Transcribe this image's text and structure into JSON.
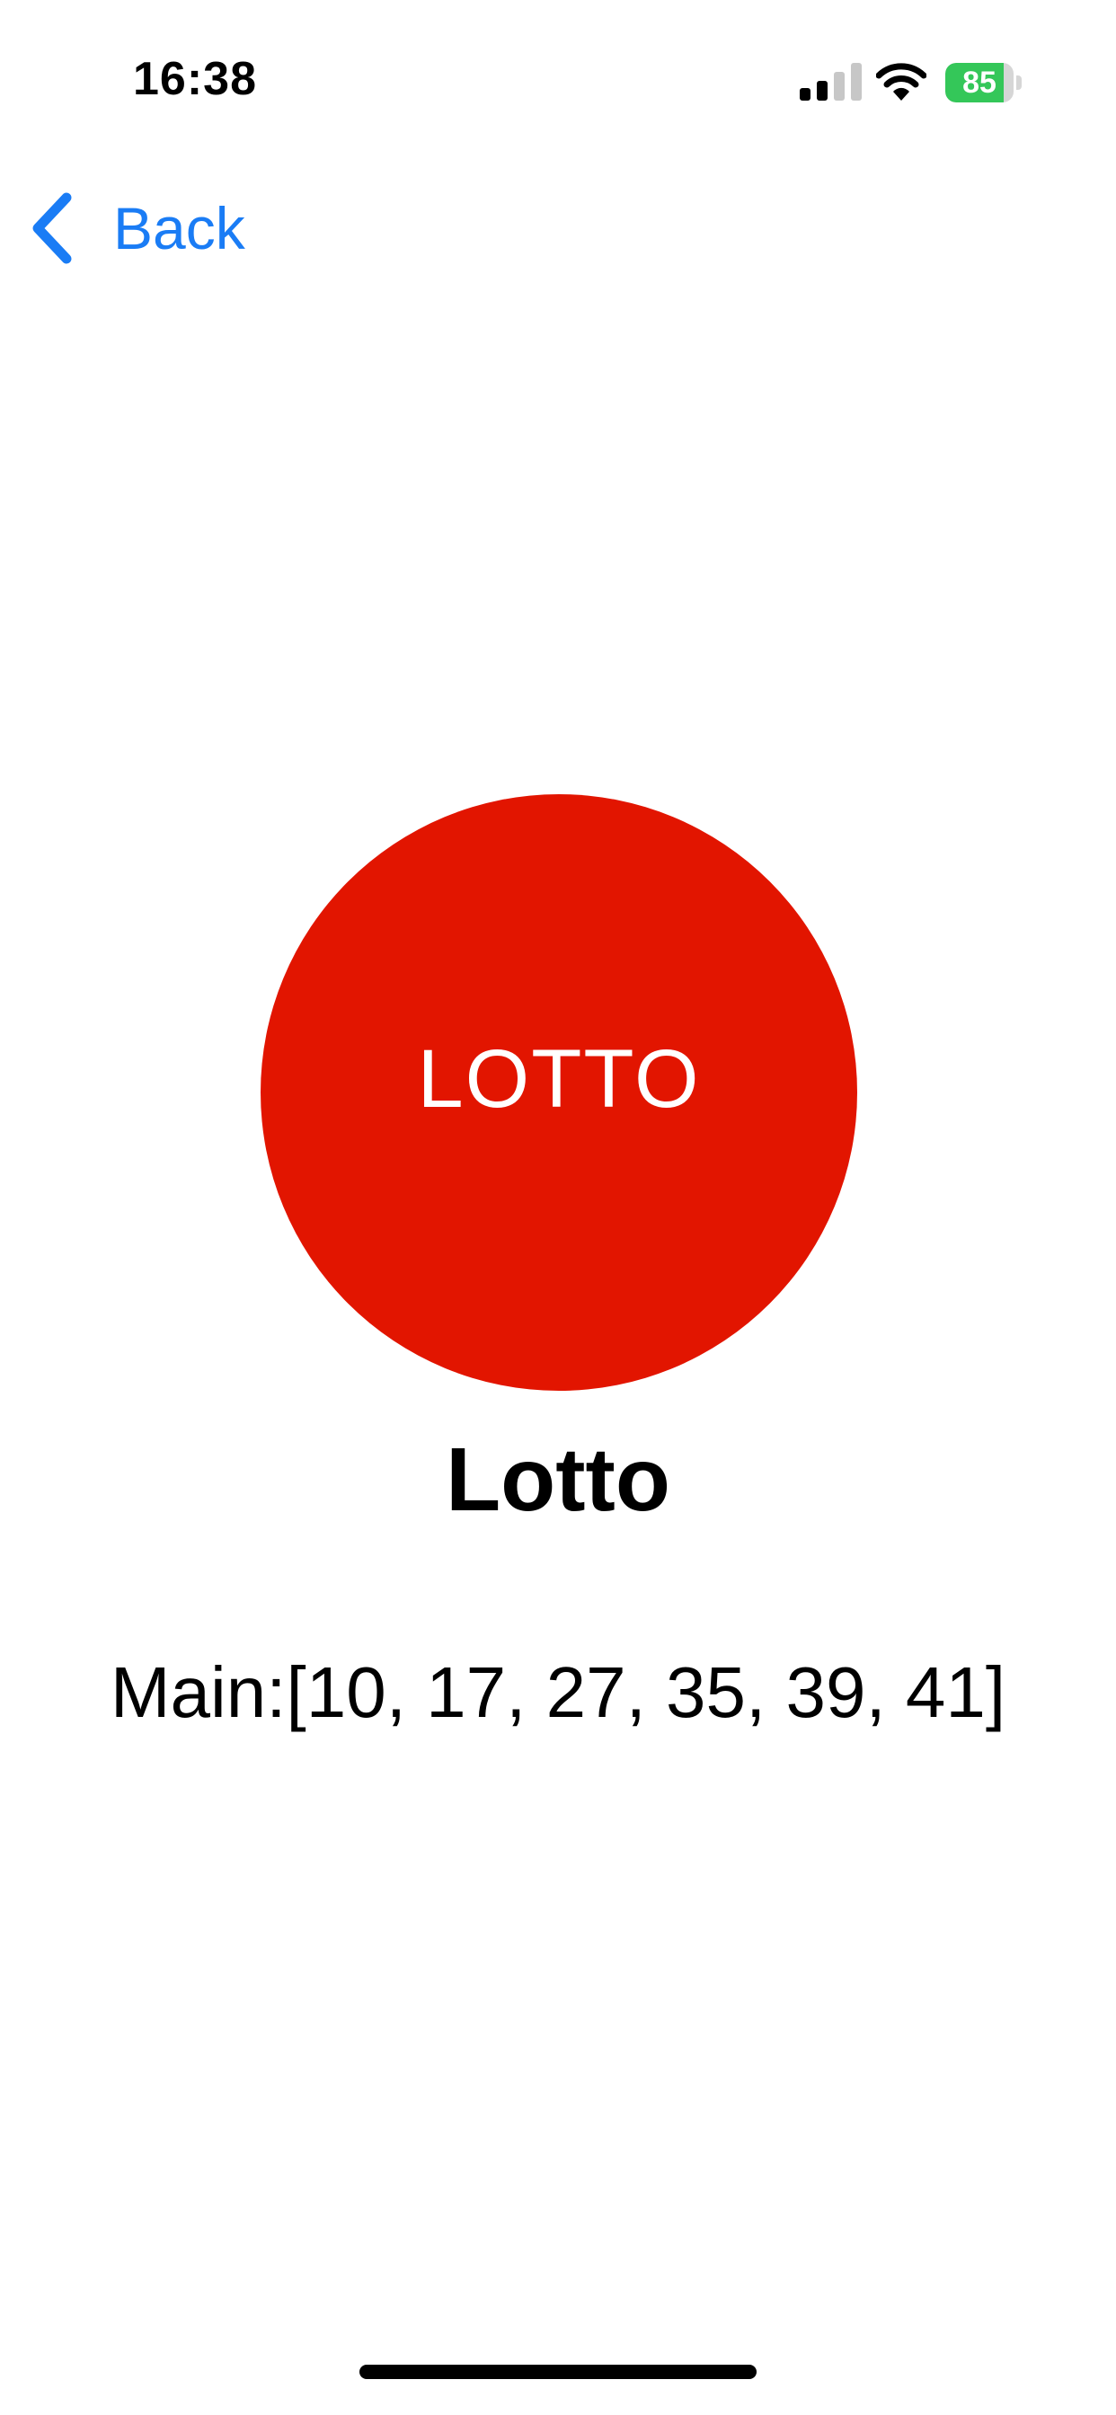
{
  "status_bar": {
    "time": "16:38",
    "battery_percent": "85",
    "battery_level": 0.85,
    "signal_bars_active": 2,
    "signal_bars_total": 4
  },
  "nav": {
    "back_label": "Back"
  },
  "lotto": {
    "logo_text": "LOTTO",
    "title": "Lotto",
    "main_numbers": "Main:[10, 17, 27, 35, 39, 41]"
  },
  "colors": {
    "accent": "#1a7cf5",
    "logo_red": "#e21500",
    "battery_green": "#34c759"
  },
  "icons": {
    "back": "chevron-left-icon",
    "signal": "cellular-signal-icon",
    "wifi": "wifi-icon",
    "battery": "battery-charging-icon"
  }
}
